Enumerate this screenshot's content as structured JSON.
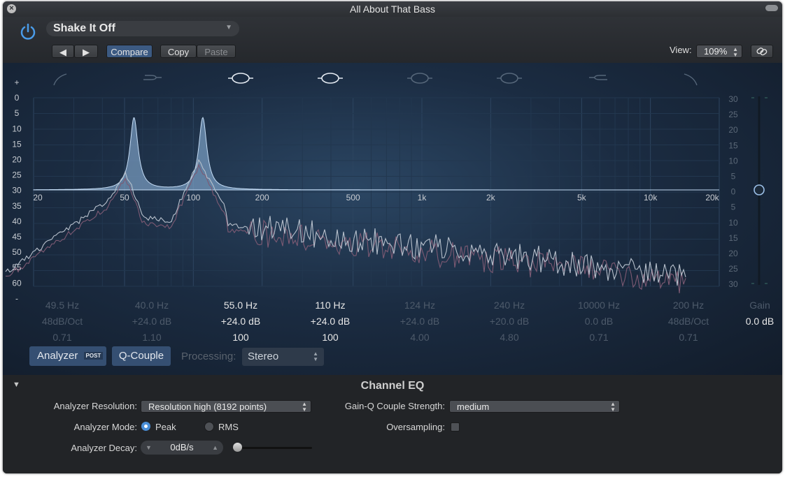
{
  "window": {
    "title": "All About That Bass"
  },
  "toolbar": {
    "preset": "Shake It Off",
    "prev_icon": "triangle-left",
    "next_icon": "triangle-right",
    "compare": "Compare",
    "copy": "Copy",
    "paste": "Paste",
    "view_label": "View:",
    "view_value": "109%"
  },
  "graph": {
    "db_left": [
      "+",
      "0",
      "5",
      "10",
      "15",
      "20",
      "25",
      "30",
      "35",
      "40",
      "45",
      "50",
      "55",
      "60",
      "-"
    ],
    "db_right": [
      "30",
      "25",
      "20",
      "15",
      "10",
      "5",
      "0",
      "5",
      "10",
      "15",
      "20",
      "25",
      "30"
    ],
    "freq_labels": [
      "20",
      "50",
      "100",
      "200",
      "500",
      "1k",
      "2k",
      "5k",
      "10k",
      "20k"
    ]
  },
  "bands": [
    {
      "freq": "49.5 Hz",
      "gain": "48dB/Oct",
      "q": "0.71",
      "active": false
    },
    {
      "freq": "40.0 Hz",
      "gain": "+24.0 dB",
      "q": "1.10",
      "active": false
    },
    {
      "freq": "55.0 Hz",
      "gain": "+24.0 dB",
      "q": "100",
      "active": true
    },
    {
      "freq": "110 Hz",
      "gain": "+24.0 dB",
      "q": "100",
      "active": true
    },
    {
      "freq": "124 Hz",
      "gain": "+24.0 dB",
      "q": "4.00",
      "active": false
    },
    {
      "freq": "240 Hz",
      "gain": "+20.0 dB",
      "q": "4.80",
      "active": false
    },
    {
      "freq": "10000 Hz",
      "gain": "0.0 dB",
      "q": "0.71",
      "active": false
    },
    {
      "freq": "200 Hz",
      "gain": "48dB/Oct",
      "q": "0.71",
      "active": false
    }
  ],
  "gain": {
    "label": "Gain",
    "value": "0.0 dB"
  },
  "controls": {
    "analyzer": "Analyzer",
    "post": "POST",
    "qcouple": "Q-Couple",
    "processing_label": "Processing:",
    "processing_value": "Stereo"
  },
  "settings": {
    "plugin_name": "Channel EQ",
    "analyzer_resolution_label": "Analyzer Resolution:",
    "analyzer_resolution_value": "Resolution high (8192 points)",
    "gain_q_label": "Gain-Q Couple Strength:",
    "gain_q_value": "medium",
    "analyzer_mode_label": "Analyzer Mode:",
    "mode_peak": "Peak",
    "mode_rms": "RMS",
    "oversampling_label": "Oversampling:",
    "analyzer_decay_label": "Analyzer Decay:",
    "analyzer_decay_value": "0dB/s"
  },
  "colors": {
    "accent": "#4a8fd8",
    "active_button": "#354f72"
  }
}
